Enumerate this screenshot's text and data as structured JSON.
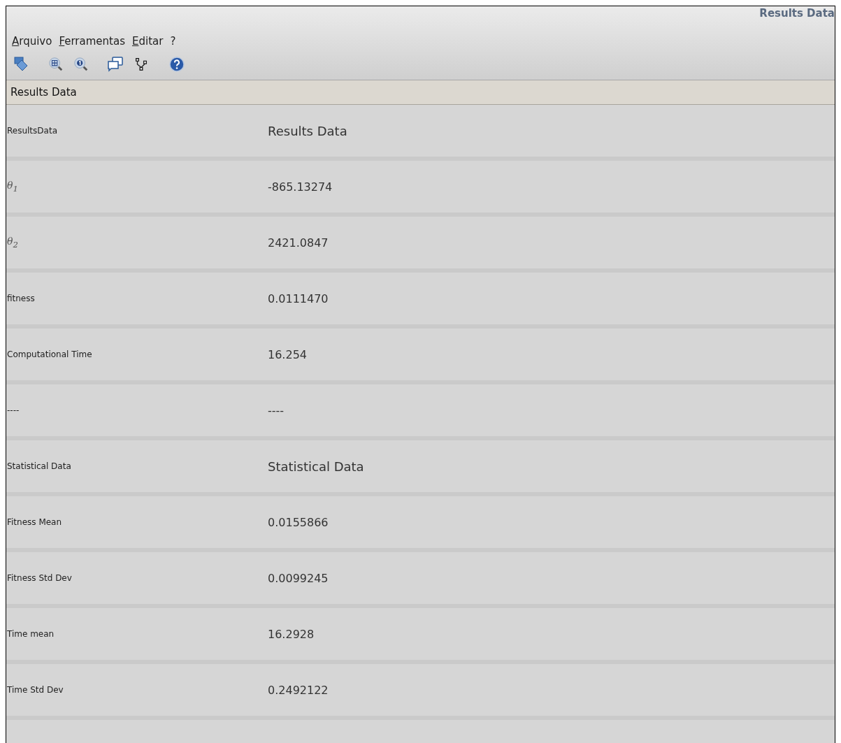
{
  "window": {
    "title": "Results Data"
  },
  "menu": [
    "Arquivo",
    "Ferramentas",
    "Editar",
    "?"
  ],
  "panel": {
    "title": "Results Data"
  },
  "rows": [
    {
      "kind": "heading",
      "label": "ResultsData",
      "value": "Results Data"
    },
    {
      "kind": "value",
      "label": "θ$_{1}$",
      "value": "-865.13274"
    },
    {
      "kind": "value",
      "label": "θ$_{2}$",
      "value": "2421.0847"
    },
    {
      "kind": "value",
      "label": "fitness",
      "value": "0.0111470"
    },
    {
      "kind": "value",
      "label": "Computational Time",
      "value": "16.254"
    },
    {
      "kind": "value",
      "label": "----",
      "value": "----"
    },
    {
      "kind": "heading",
      "label": "Statistical Data",
      "value": "Statistical Data"
    },
    {
      "kind": "value",
      "label": "Fitness Mean",
      "value": "0.0155866"
    },
    {
      "kind": "value",
      "label": "Fitness Std Dev",
      "value": "0.0099245"
    },
    {
      "kind": "value",
      "label": "Time mean",
      "value": "16.2928"
    },
    {
      "kind": "value",
      "label": "Time Std Dev",
      "value": "0.2492122"
    }
  ]
}
